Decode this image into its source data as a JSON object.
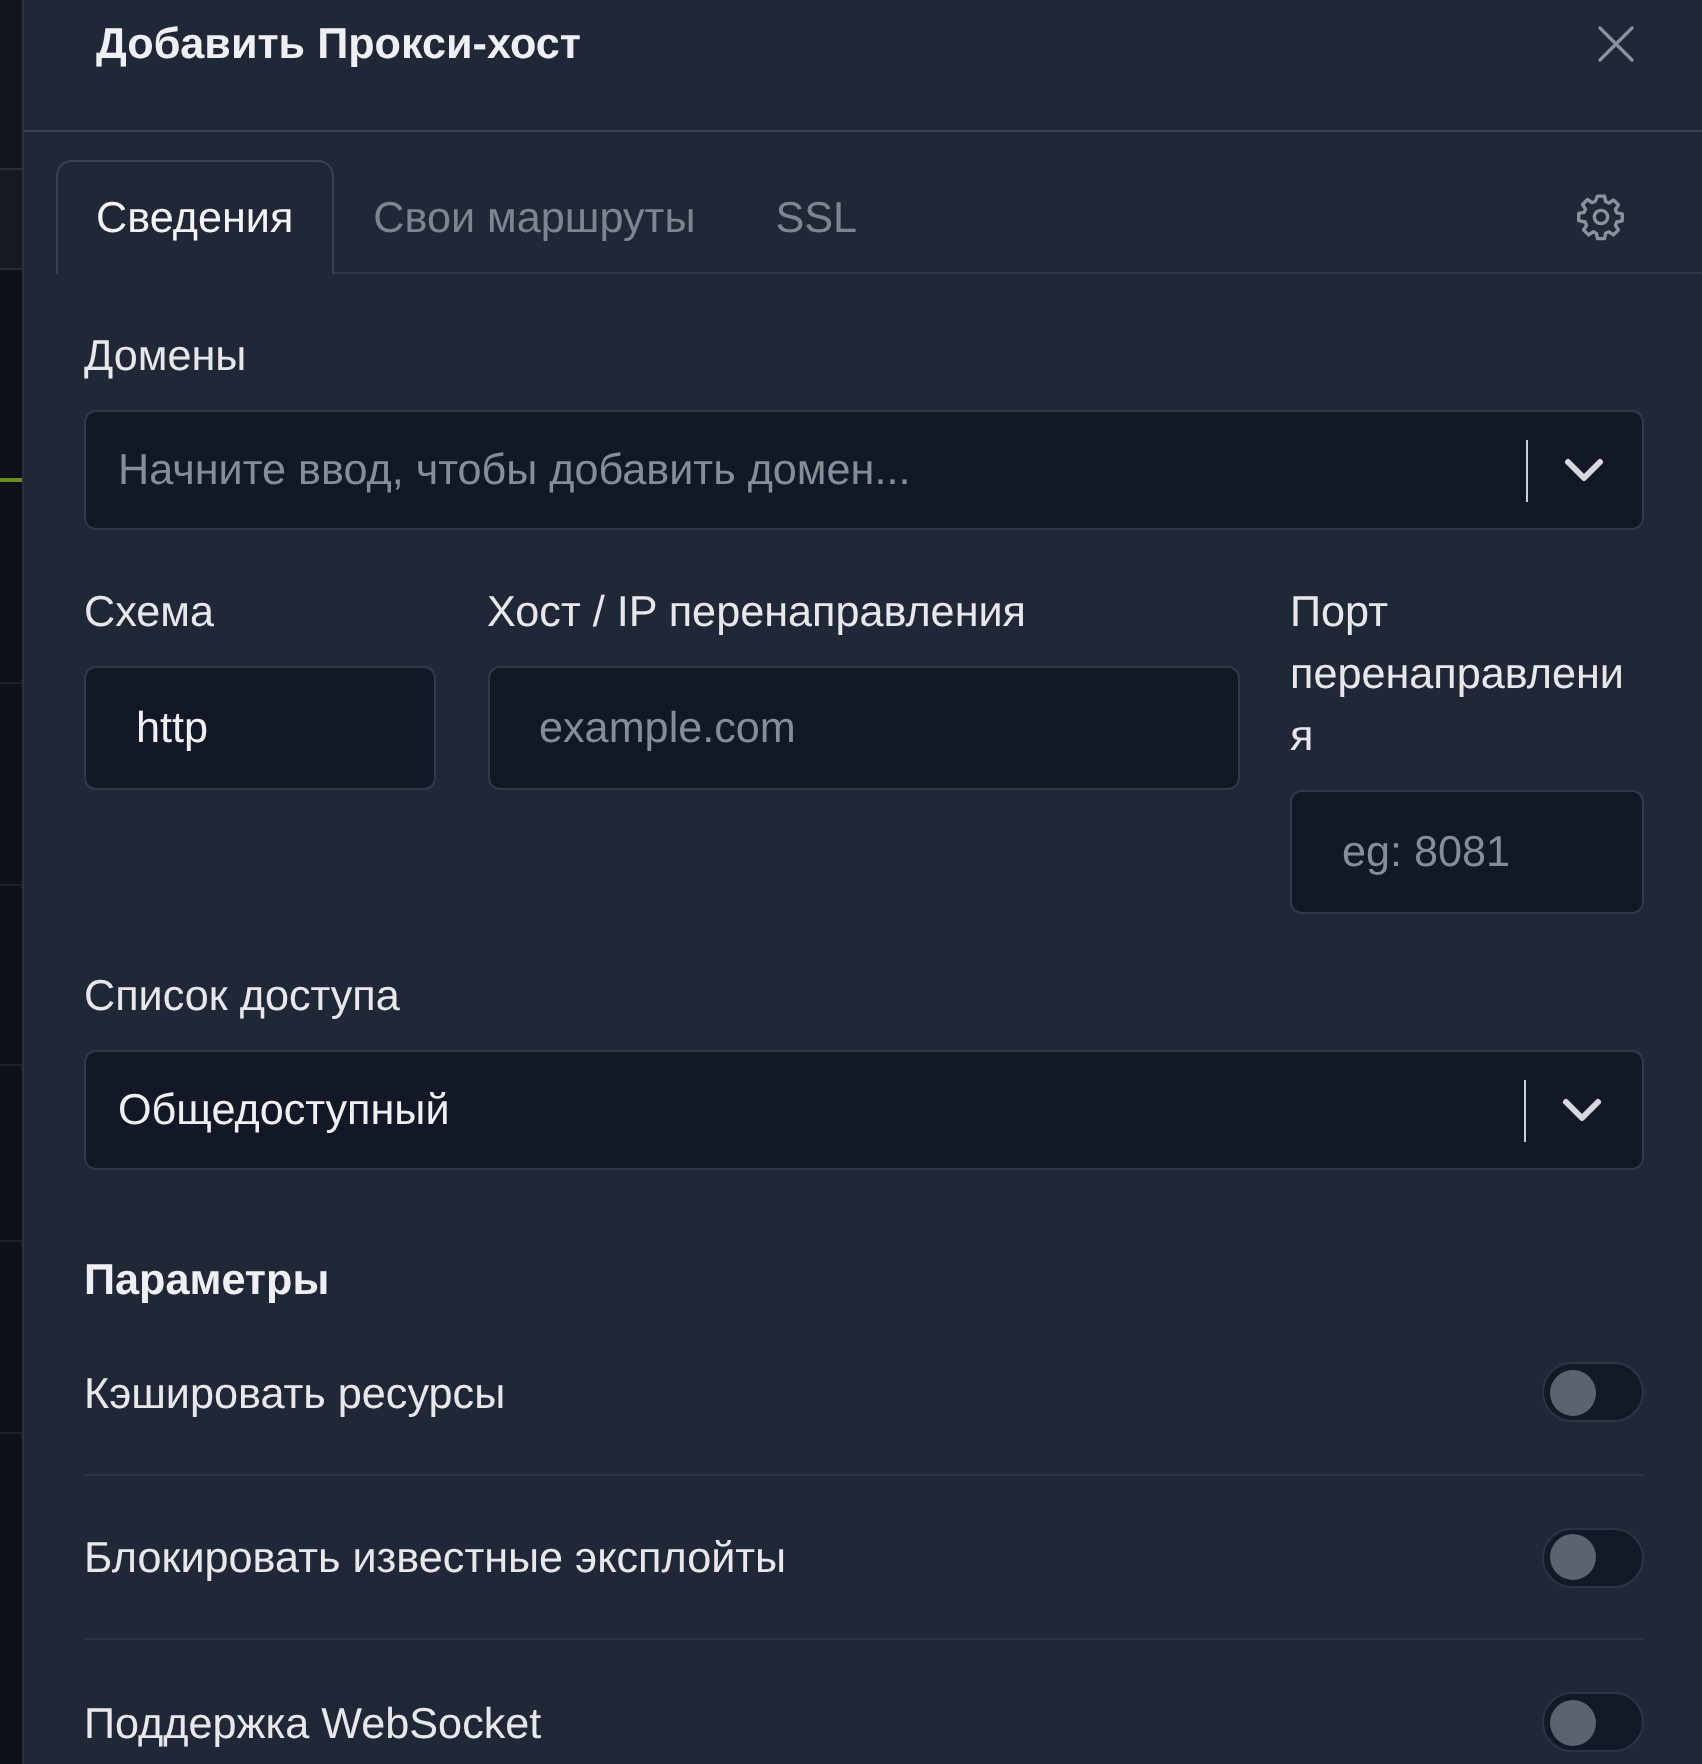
{
  "modal": {
    "title": "Добавить Прокси-хост"
  },
  "tabs": [
    {
      "label": "Сведения",
      "selected": true
    },
    {
      "label": "Свои маршруты",
      "selected": false
    },
    {
      "label": "SSL",
      "selected": false
    }
  ],
  "domains": {
    "label": "Домены",
    "placeholder": "Начните ввод, чтобы добавить домен..."
  },
  "forward": [
    {
      "label": "Схема",
      "value": "http"
    },
    {
      "label": "Хост / IP перенаправления",
      "placeholder": "example.com"
    },
    {
      "label": "Порт перенаправления",
      "placeholder": "eg: 8081"
    }
  ],
  "access_list": {
    "label": "Список доступа",
    "value": "Общедоступный"
  },
  "options": {
    "title": "Параметры",
    "items": [
      {
        "label": "Кэшировать ресурсы",
        "on": false
      },
      {
        "label": "Блокировать известные эксплойты",
        "on": false
      },
      {
        "label": "Поддержка WebSocket",
        "on": false
      }
    ]
  }
}
